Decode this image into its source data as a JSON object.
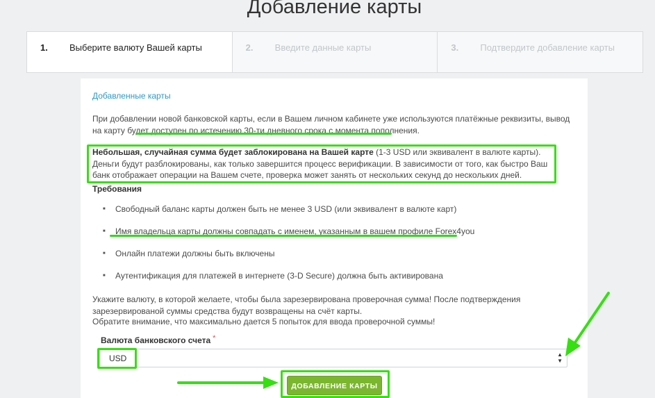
{
  "page": {
    "title": "Добавление карты"
  },
  "steps": [
    {
      "num": "1.",
      "label": "Выберите валюту Вашей карты"
    },
    {
      "num": "2.",
      "label": "Введите данные карты"
    },
    {
      "num": "3.",
      "label": "Подтвердите добавление карты"
    }
  ],
  "content": {
    "section_title": "Добавленные карты",
    "para1_start": "При добавлении новой банковской карты, если в Вашем личном кабинете уже используются платёжные реквизиты, вывод на карту будет ",
    "para1_highlight": "доступен по истечению 30-ти дневного срока с момента пополнения",
    "para1_end": ".",
    "para2_bold": "Небольшая, случайная сумма будет заблокирована на Вашей карте",
    "para2_rest": " (1-3 USD или эквивалент в валюте карты). Деньги будут разблокированы, как только завершится процесс верификации. В зависимости от того, как быстро Ваш банк отображает операции на Вашем счете, проверка может занять от нескольких секунд до нескольких дней.",
    "requirements_title": "Требования",
    "requirements": [
      "Свободный баланс карты должен быть не менее 3 USD (или эквивалент в валюте карт)",
      "Имя владельца карты должны совпадать с именем, указанным в вашем профиле Forex4you",
      "Онлайн платежи должны быть включены",
      "Аутентификация для платежей в интернете (3-D Secure) должна быть активирована"
    ],
    "para3": "Укажите валюту, в которой желаете, чтобы была зарезервирована проверочная сумма! После подтверждения зарезервированой суммы средства будут возвращены на счёт карты.",
    "para4": "Обратите внимание, что максимально дается 5 попыток для ввода проверочной суммы!"
  },
  "form": {
    "currency_label": "Валюта банковского счета",
    "required_mark": "*",
    "currency_value": "USD",
    "submit_label": "ДОБАВЛЕНИЕ КАРТЫ"
  },
  "colors": {
    "accent_link": "#2b9acb",
    "button": "#7bb62f",
    "annotation": "#35e010",
    "background": "#eef0f2"
  }
}
